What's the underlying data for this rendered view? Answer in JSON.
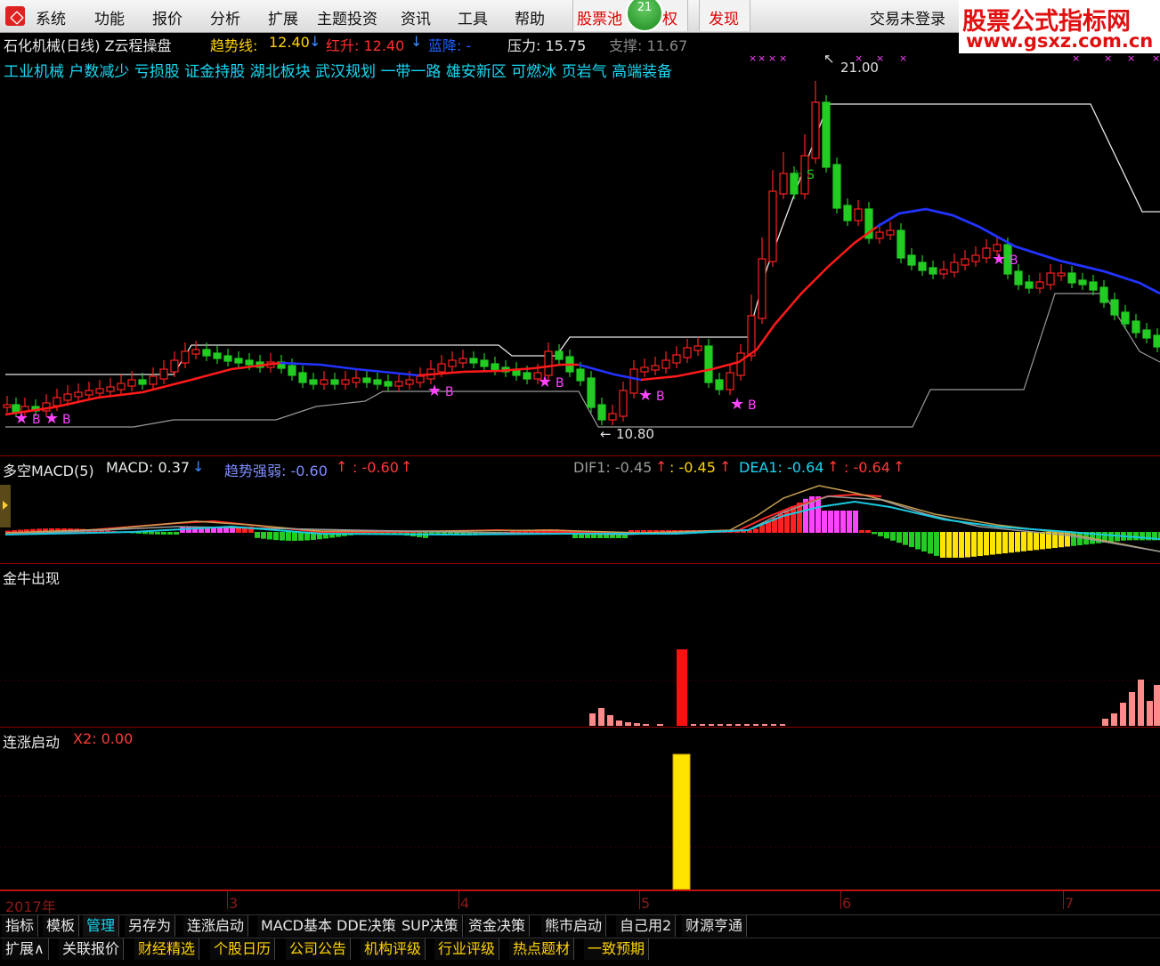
{
  "menu": {
    "items": [
      "系统",
      "功能",
      "报价",
      "分析",
      "扩展",
      "主题投资",
      "资讯",
      "工具",
      "帮助"
    ],
    "stock_pool": "股票池",
    "stock_pool_badge": "21",
    "stock_pool_tail": "权",
    "discover": "发现",
    "login_status": "交易未登录"
  },
  "watermark": {
    "title": "股票公式指标网",
    "url": "www.gsxz.com.cn"
  },
  "main_chart": {
    "stock_title": "石化机械(日线) Z云程操盘",
    "trend_label": "趋势线:",
    "trend_value": "12.40",
    "red_rise": "红升: 12.40",
    "blue_fall": "蓝降: -",
    "pressure": "压力: 15.75",
    "support": "支撑: 11.67",
    "concepts": [
      "工业机械",
      "户数减少",
      "亏损股",
      "证金持股",
      "湖北板块",
      "武汉规划",
      "一带一路",
      "雄安新区",
      "可燃冰",
      "页岩气",
      "高端装备"
    ],
    "high_label": "21.00",
    "low_label": "10.80",
    "buy_marker": "B",
    "sell_marker": "S",
    "colors": {
      "up": "#ff2020",
      "down": "#22cc22",
      "trend_up": "#ff2020",
      "trend_down": "#2222ff",
      "pressure": "#ffffff",
      "support": "#999999",
      "marker": "#ff44ff"
    }
  },
  "macd_panel": {
    "title": "多空MACD(5)",
    "macd": "MACD: 0.37",
    "trend_strength": "趋势强弱: -0.60",
    "trend_strength2": ": -0.60",
    "dif": "DIF1: -0.45",
    "dif2": ": -0.45",
    "dea": "DEA1: -0.64",
    "dea2": ": -0.64"
  },
  "golden_bull_panel": {
    "title": "金牛出现"
  },
  "rally_panel": {
    "title": "连涨启动",
    "x2": "X2: 0.00"
  },
  "time_axis": {
    "labels": [
      "2017年",
      "3",
      "4",
      "5",
      "6",
      "7"
    ]
  },
  "tabs_row1": [
    "指标",
    "模板",
    "管理",
    "另存为",
    "连涨启动",
    "MACD基本",
    "DDE决策",
    "SUP决策",
    "资金决策",
    "熊市启动",
    "自己用2",
    "财源亨通"
  ],
  "tabs_row2": [
    "扩展∧",
    "关联报价",
    "财经精选",
    "个股日历",
    "公司公告",
    "机构评级",
    "行业评级",
    "热点题材",
    "一致预期"
  ]
}
